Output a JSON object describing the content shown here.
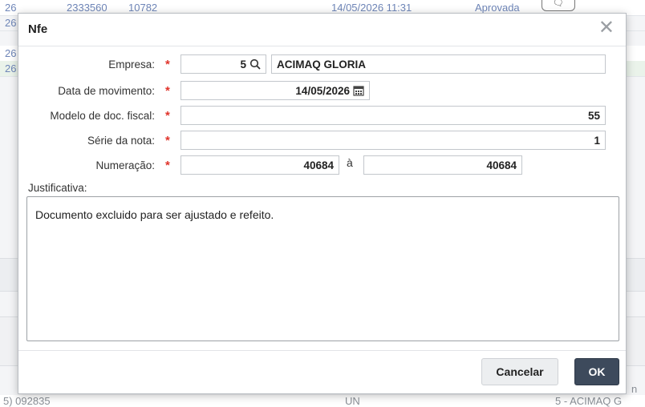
{
  "background": {
    "top_row": {
      "col_a": "26",
      "col_b": "2333560",
      "col_c": "10782",
      "date": "14/05/2026 11:31",
      "status": "Aprovada"
    },
    "side_rows": [
      "26",
      "26",
      "26"
    ],
    "bottom_row": {
      "col_a": "5) 092835",
      "unit": "UN",
      "company": "5 - ACIMAQ G"
    },
    "side_char": "n"
  },
  "modal": {
    "title": "Nfe",
    "fields": {
      "empresa": {
        "label": "Empresa:",
        "code": "5",
        "name": "ACIMAQ GLORIA"
      },
      "data_movimento": {
        "label": "Data de movimento:",
        "value": "14/05/2026"
      },
      "modelo_doc": {
        "label": "Modelo de doc. fiscal:",
        "value": "55"
      },
      "serie": {
        "label": "Série da nota:",
        "value": "1"
      },
      "numeracao": {
        "label": "Numeração:",
        "from": "40684",
        "separator": "à",
        "to": "40684"
      }
    },
    "required_mark": "*",
    "justificativa": {
      "label": "Justificativa:",
      "value": "Documento excluido para ser ajustado e refeito."
    },
    "buttons": {
      "cancel": "Cancelar",
      "ok": "OK"
    }
  },
  "colors": {
    "required": "#e0342b",
    "ok_button": "#3d4a5c",
    "link_blue": "#6f86b8"
  },
  "icons": [
    "search-icon",
    "calendar-icon",
    "close-icon",
    "chat-icon"
  ]
}
